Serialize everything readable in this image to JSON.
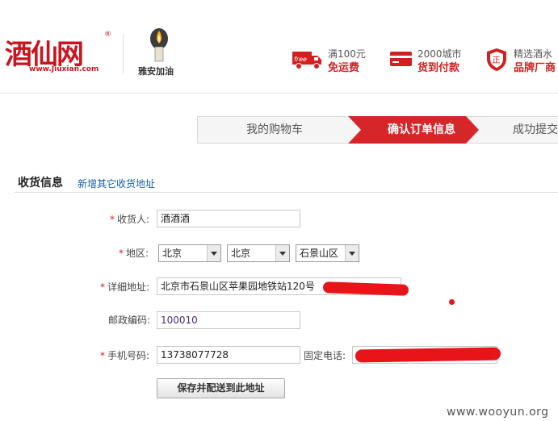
{
  "header": {
    "logo_text": "酒仙网",
    "logo_url": "www.Jiuxian.com",
    "logo_reg": "®",
    "campaign_label": "雅安加油",
    "perks": [
      {
        "icon": "truck-free-icon",
        "line1": "满100元",
        "line2": "免运费"
      },
      {
        "icon": "card-icon",
        "line1": "2000城市",
        "line2": "货到付款"
      },
      {
        "icon": "shield-icon",
        "line1": "精选酒水",
        "line2": "品牌厂商"
      }
    ],
    "truck_badge": "free",
    "shield_char": "正"
  },
  "steps": {
    "cart": "我的购物车",
    "confirm": "确认订单信息",
    "done": "成功提交"
  },
  "section": {
    "title": "收货信息",
    "add_link": "新增其它收货地址"
  },
  "form": {
    "receiver_label": "收货人:",
    "receiver_value": "酒酒酒",
    "region_label": "地区:",
    "province": "北京",
    "city": "北京",
    "district": "石景山区",
    "address_label": "详细地址:",
    "address_value": "北京市石景山区苹果园地铁站120号",
    "postcode_label": "邮政编码:",
    "postcode_value": "100010",
    "mobile_label": "手机号码:",
    "mobile_value": "13738077728",
    "phone_label": "固定电话:",
    "required_mark": "*"
  },
  "save_button": "保存并配送到此地址",
  "watermark": "www.wooyun.org",
  "colors": {
    "brand_red": "#c9151e",
    "step_active": "#d6262a",
    "link_blue": "#1a5fa6"
  }
}
